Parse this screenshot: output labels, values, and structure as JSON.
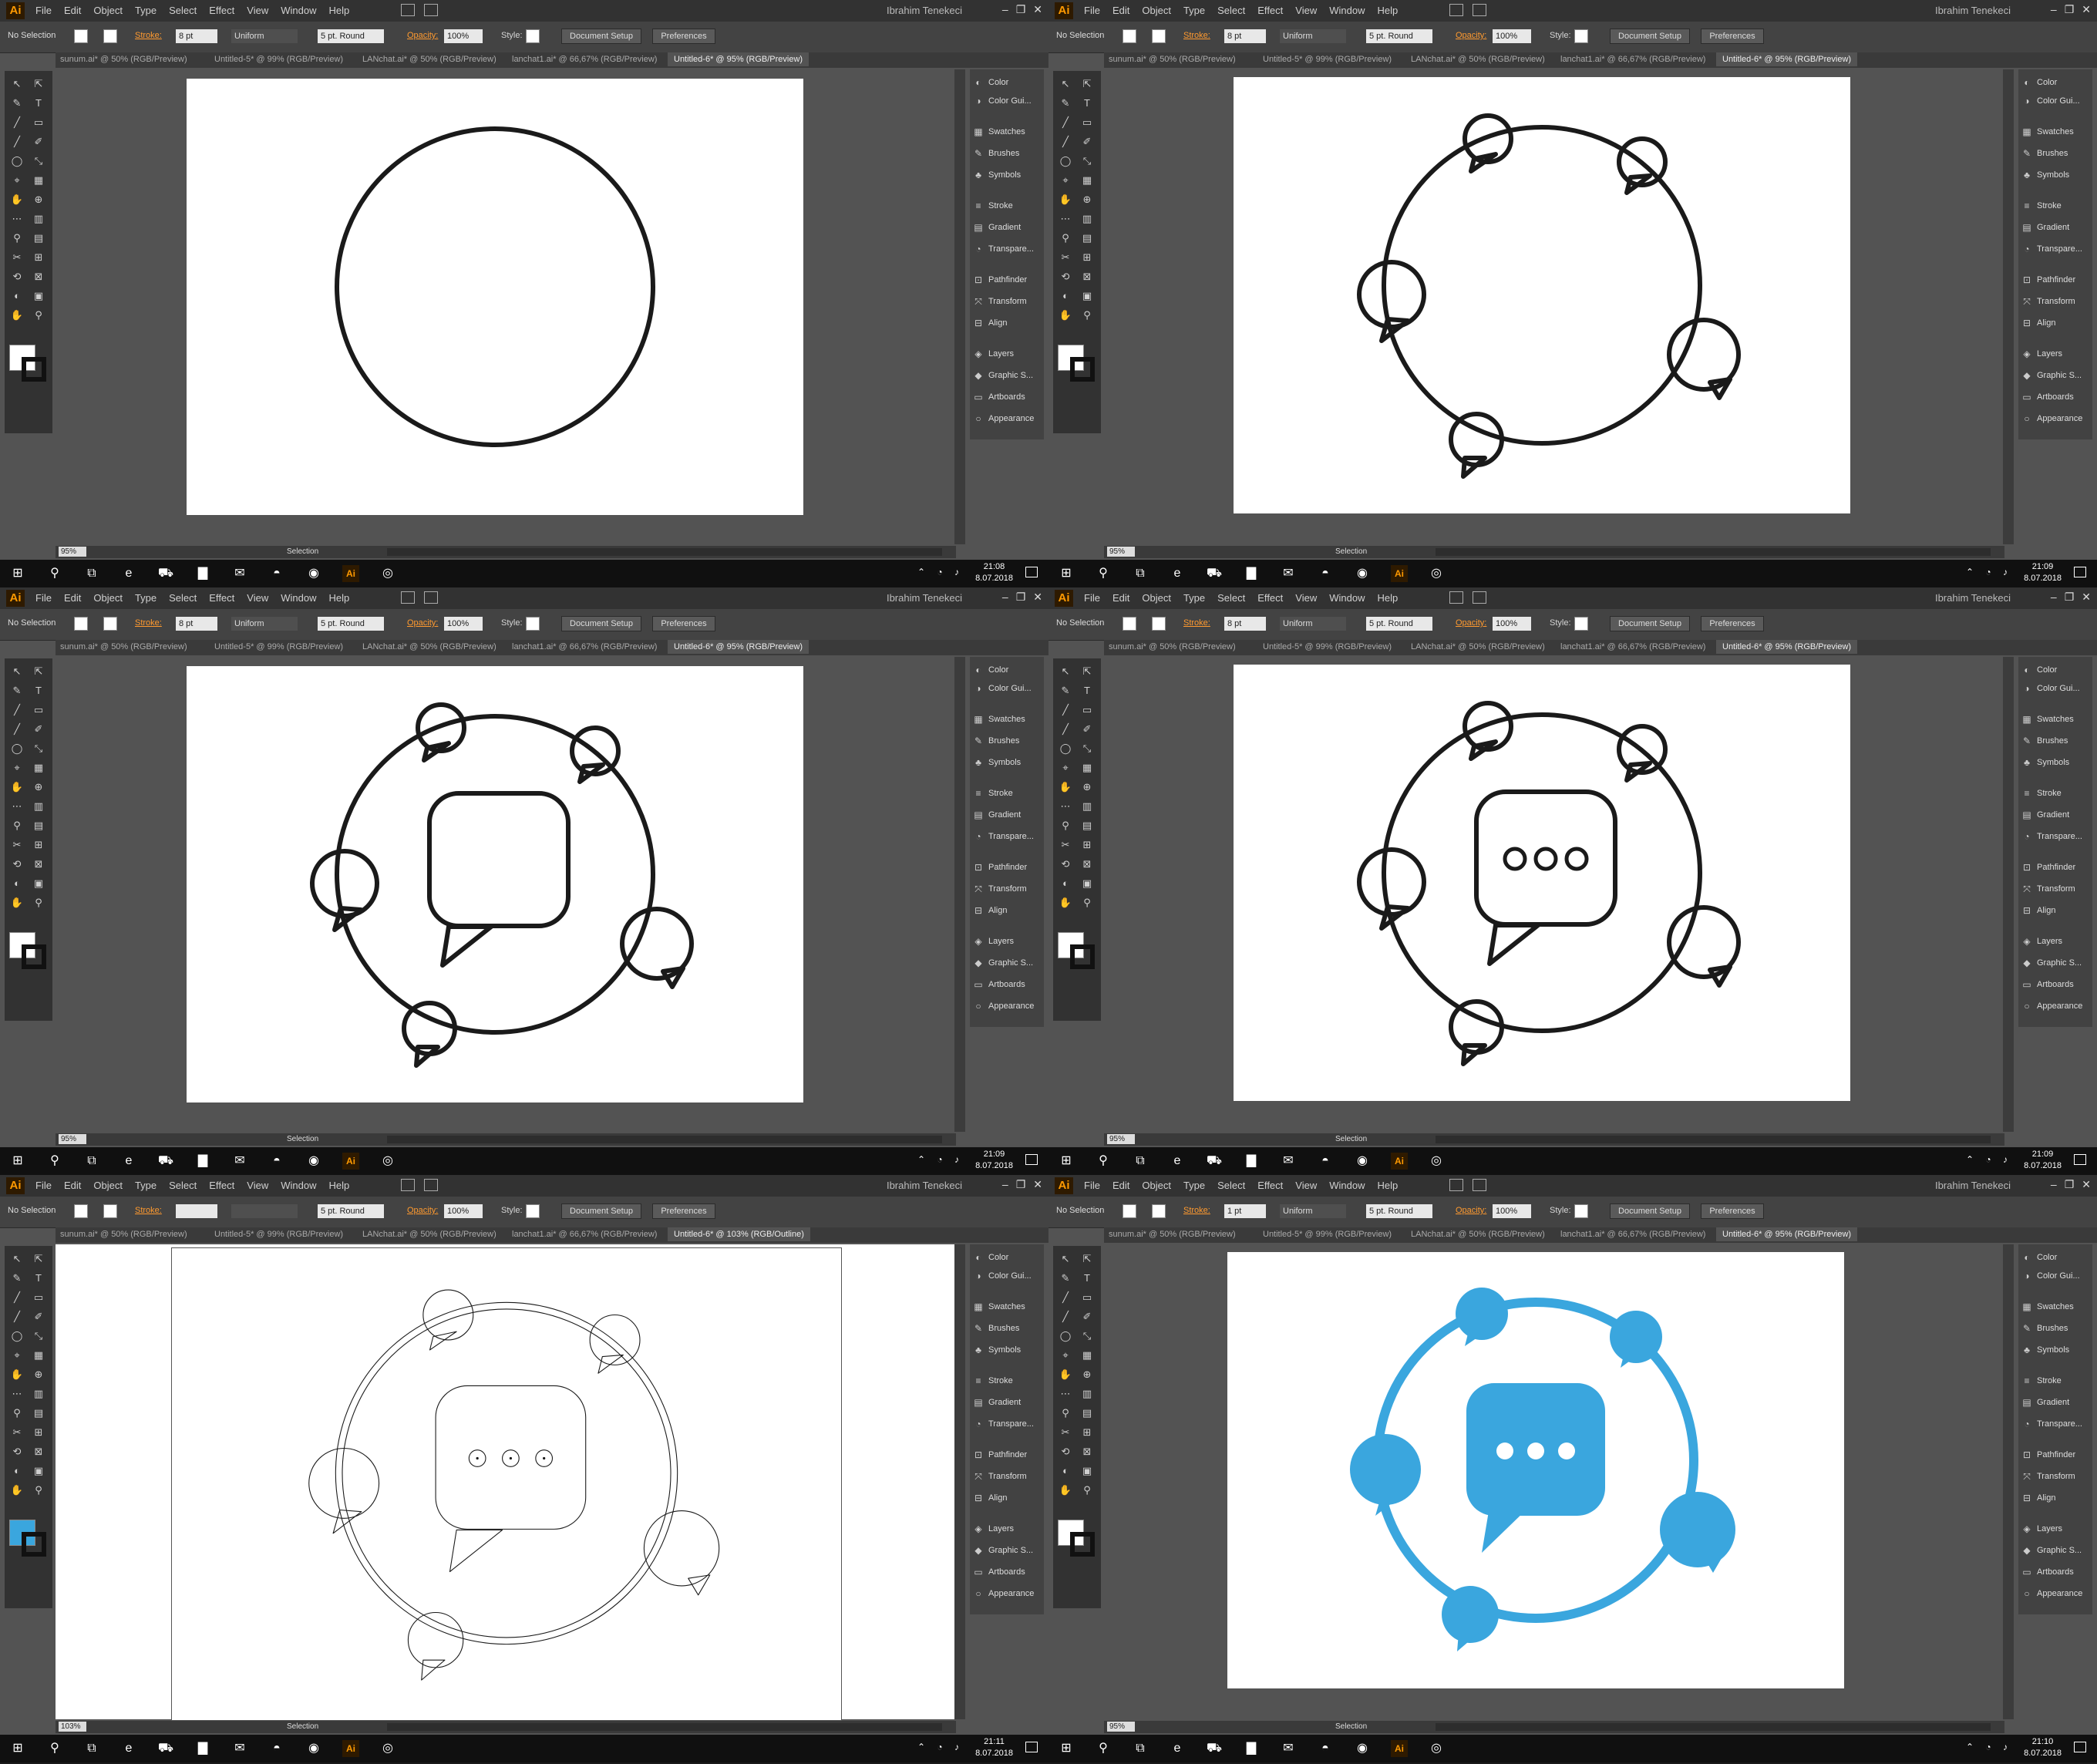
{
  "app": {
    "logo": "Ai",
    "menu": [
      "File",
      "Edit",
      "Object",
      "Type",
      "Select",
      "Effect",
      "View",
      "Window",
      "Help"
    ],
    "user": "Ibrahim Tenekeci",
    "window_controls": [
      "–",
      "❐",
      "✕"
    ]
  },
  "control_bar": {
    "selection": "No Selection",
    "stroke_label": "Stroke:",
    "stroke_weight": "8 pt",
    "profile": "Uniform",
    "brush": "5 pt. Round",
    "opacity_label": "Opacity:",
    "opacity": "100%",
    "style_label": "Style:",
    "document_setup": "Document Setup",
    "preferences": "Preferences"
  },
  "tabs": [
    "sunum.ai* @ 50% (RGB/Preview)",
    "Untitled-5* @ 99% (RGB/Preview)",
    "LANchat.ai* @ 50% (RGB/Preview)",
    "lanchat1.ai* @ 66,67% (RGB/Preview)",
    "Untitled-6* @ 95% (RGB/Preview)"
  ],
  "dock": [
    "Color",
    "Color Gui...",
    "Swatches",
    "Brushes",
    "Symbols",
    "Stroke",
    "Gradient",
    "Transpare...",
    "Pathfinder",
    "Transform",
    "Align",
    "Layers",
    "Graphic S...",
    "Artboards",
    "Appearance"
  ],
  "status": {
    "zoom": "95%",
    "page": "1",
    "tool": "Selection"
  },
  "taskbar": {
    "date": "8.07.2018"
  },
  "colors": {
    "accent_blue": "#3aa6de",
    "stroke_black": "#1a1a1a",
    "ui_dark": "#535353"
  },
  "panels": [
    {
      "time": "21:08",
      "stage": "circle",
      "zoom": "95%",
      "active_tab_title": "Untitled-6* @ 95% (RGB/Preview)"
    },
    {
      "time": "21:09",
      "stage": "bubbles",
      "zoom": "95%",
      "active_tab_title": "Untitled-6* @ 95% (RGB/Preview)"
    },
    {
      "time": "21:09",
      "stage": "center",
      "zoom": "95%",
      "active_tab_title": "Untitled-6* @ 95% (RGB/Preview)"
    },
    {
      "time": "21:09",
      "stage": "dots",
      "zoom": "95%",
      "active_tab_title": "Untitled-6* @ 95% (RGB/Preview)"
    },
    {
      "time": "21:11",
      "stage": "outline",
      "zoom": "103%",
      "active_tab_title": "Untitled-6* @ 103% (RGB/Outline)",
      "stroke_weight": "",
      "profile": ""
    },
    {
      "time": "21:10",
      "stage": "final",
      "zoom": "95%",
      "active_tab_title": "Untitled-6* @ 95% (RGB/Preview)",
      "stroke_weight": "1 pt"
    }
  ]
}
